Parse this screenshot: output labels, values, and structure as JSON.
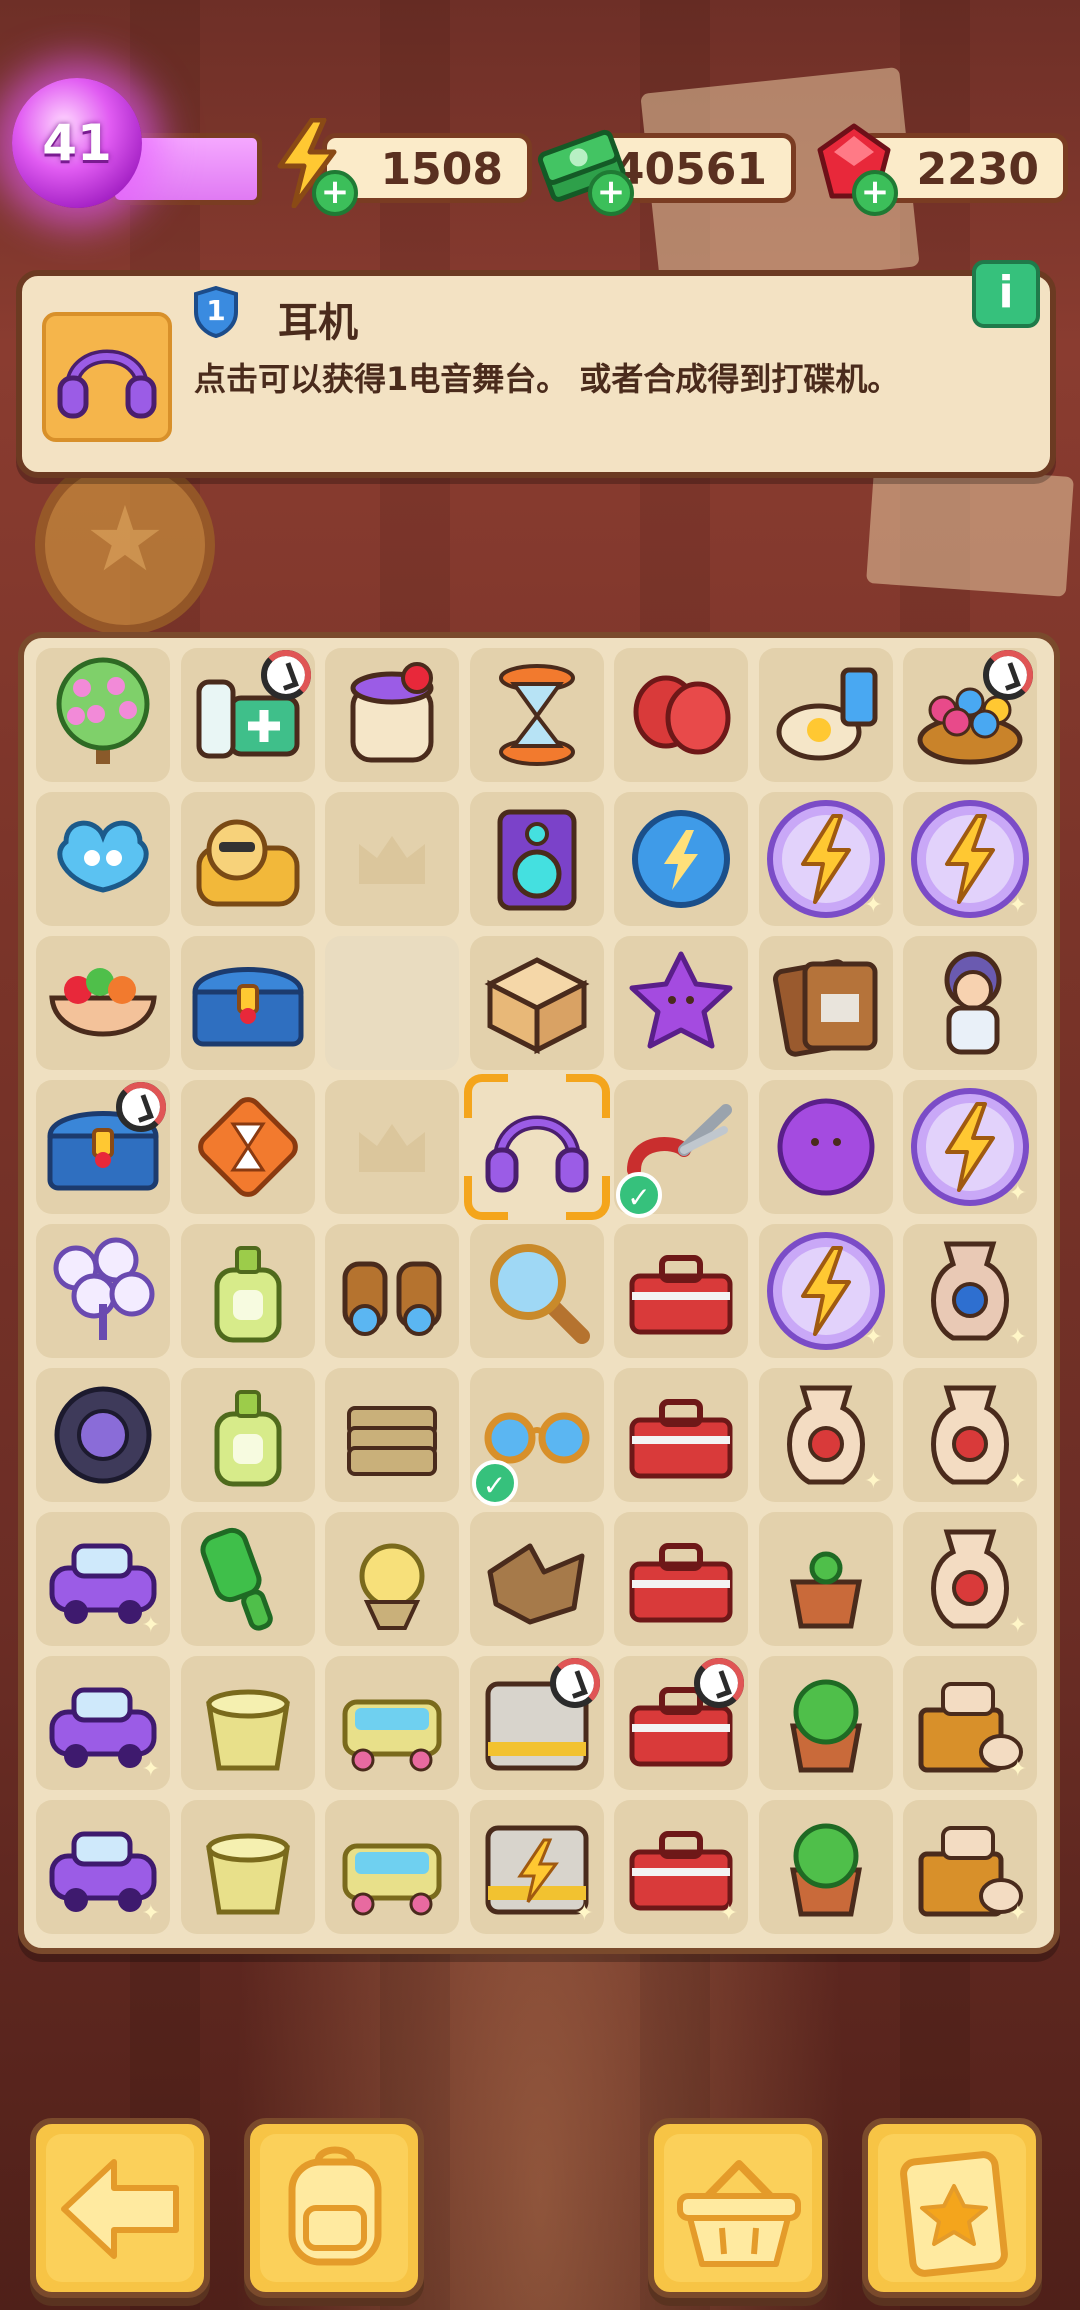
{
  "hud": {
    "level": "41",
    "energy": "1508",
    "cash": "40561",
    "gems": "2230"
  },
  "info": {
    "item_level": "1",
    "item_name": "耳机",
    "description": "点击可以获得1电音舞台。 或者合成得到打碟机。",
    "info_button": "i"
  },
  "board": {
    "rows": 9,
    "cols": 7,
    "items": [
      [
        "flower-tree",
        "medicine-kit",
        "jam-jar",
        "hourglass-stand",
        "boxing-gloves",
        "breakfast-plate",
        "flower-basket"
      ],
      [
        "scissors-token",
        "cat-sofa",
        "empty",
        "speaker",
        "energy-orb-small",
        "energy-orb",
        "energy-orb"
      ],
      [
        "fruit-salad",
        "treasure-chest",
        "blank",
        "puzzle-box",
        "purple-star-slime",
        "envelope-pack",
        "grandma-chef"
      ],
      [
        "treasure-chest",
        "hourglass-tile",
        "empty",
        "headphones",
        "pruning-shears",
        "purple-blob",
        "energy-orb"
      ],
      [
        "lamp-cluster",
        "lotion-bottle",
        "binoculars",
        "magnifier",
        "toolbox",
        "energy-orb",
        "vase"
      ],
      [
        "car-wheel",
        "lotion-bottle-big",
        "cloth-stack",
        "sunglasses",
        "tool-cart",
        "dragon-vase",
        "dragon-vase"
      ],
      [
        "jet-ski",
        "brush",
        "radish-doll",
        "leaf-pile",
        "tool-robot",
        "sprout-pot",
        "dragon-vase"
      ],
      [
        "toy-car",
        "bucket",
        "bathtub",
        "trash-crate",
        "tool-chest",
        "bush-pot",
        "crate-stack"
      ],
      [
        "helicopter",
        "bucket-small",
        "bath-cart",
        "energy-crate",
        "cart-bundle",
        "bush-pot-big",
        "crate-stack"
      ]
    ],
    "timers": [
      "medicine-kit",
      "flower-basket",
      "treasure-chest",
      "trash-crate",
      "tool-chest"
    ],
    "checked": [
      "pruning-shears",
      "sunglasses"
    ],
    "selected": "headphones"
  },
  "nav": {
    "back": "back-arrow-icon",
    "backpack": "backpack-icon",
    "shop": "basket-icon",
    "tasks": "clipboard-star-icon"
  },
  "colors": {
    "accent": "#f4a51c",
    "panel": "#f3e2c3",
    "board": "#efe0c1",
    "energy_orb": "#b98cf4",
    "green": "#36c17c"
  }
}
